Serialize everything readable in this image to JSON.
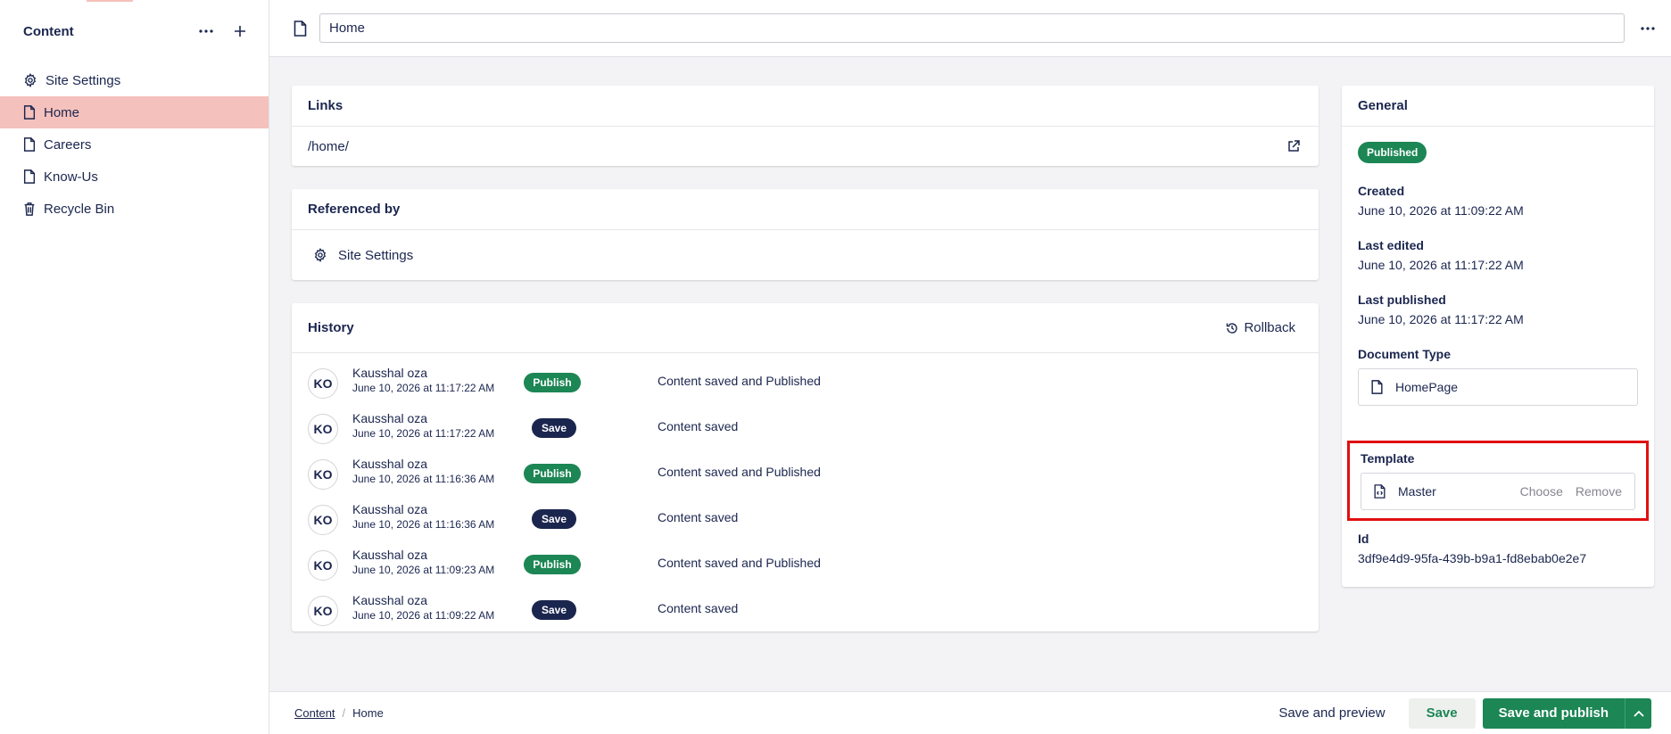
{
  "sidebar": {
    "title": "Content",
    "items": [
      {
        "label": "Site Settings",
        "icon": "gear-icon"
      },
      {
        "label": "Home",
        "icon": "document-icon",
        "active": true
      },
      {
        "label": "Careers",
        "icon": "document-icon"
      },
      {
        "label": "Know-Us",
        "icon": "document-icon"
      },
      {
        "label": "Recycle Bin",
        "icon": "trash-icon"
      }
    ]
  },
  "header": {
    "name_value": "Home"
  },
  "links": {
    "title": "Links",
    "url": "/home/"
  },
  "referenced_by": {
    "title": "Referenced by",
    "item": "Site Settings"
  },
  "history": {
    "title": "History",
    "rollback_label": "Rollback",
    "rows": [
      {
        "initials": "KO",
        "user": "Kausshal oza",
        "date": "June 10, 2026 at 11:17:22 AM",
        "action": "Publish",
        "description": "Content saved and Published"
      },
      {
        "initials": "KO",
        "user": "Kausshal oza",
        "date": "June 10, 2026 at 11:17:22 AM",
        "action": "Save",
        "description": "Content saved"
      },
      {
        "initials": "KO",
        "user": "Kausshal oza",
        "date": "June 10, 2026 at 11:16:36 AM",
        "action": "Publish",
        "description": "Content saved and Published"
      },
      {
        "initials": "KO",
        "user": "Kausshal oza",
        "date": "June 10, 2026 at 11:16:36 AM",
        "action": "Save",
        "description": "Content saved"
      },
      {
        "initials": "KO",
        "user": "Kausshal oza",
        "date": "June 10, 2026 at 11:09:23 AM",
        "action": "Publish",
        "description": "Content saved and Published"
      },
      {
        "initials": "KO",
        "user": "Kausshal oza",
        "date": "June 10, 2026 at 11:09:22 AM",
        "action": "Save",
        "description": "Content saved"
      }
    ]
  },
  "general": {
    "title": "General",
    "status": "Published",
    "created_label": "Created",
    "created_value": "June 10, 2026 at 11:09:22 AM",
    "edited_label": "Last edited",
    "edited_value": "June 10, 2026 at 11:17:22 AM",
    "published_label": "Last published",
    "published_value": "June 10, 2026 at 11:17:22 AM",
    "doctype_label": "Document Type",
    "doctype_value": "HomePage",
    "template_label": "Template",
    "template_value": "Master",
    "template_choose": "Choose",
    "template_remove": "Remove",
    "id_label": "Id",
    "id_value": "3df9e4d9-95fa-439b-b9a1-fd8ebab0e2e7"
  },
  "footer": {
    "breadcrumb_root": "Content",
    "breadcrumb_separator": "/",
    "breadcrumb_current": "Home",
    "save_preview_label": "Save and preview",
    "save_label": "Save",
    "save_publish_label": "Save and publish"
  },
  "colors": {
    "accent_active": "#f5c1bc",
    "publish_green": "#1c8654",
    "save_navy": "#1b264f",
    "highlight_red": "#e01010"
  }
}
